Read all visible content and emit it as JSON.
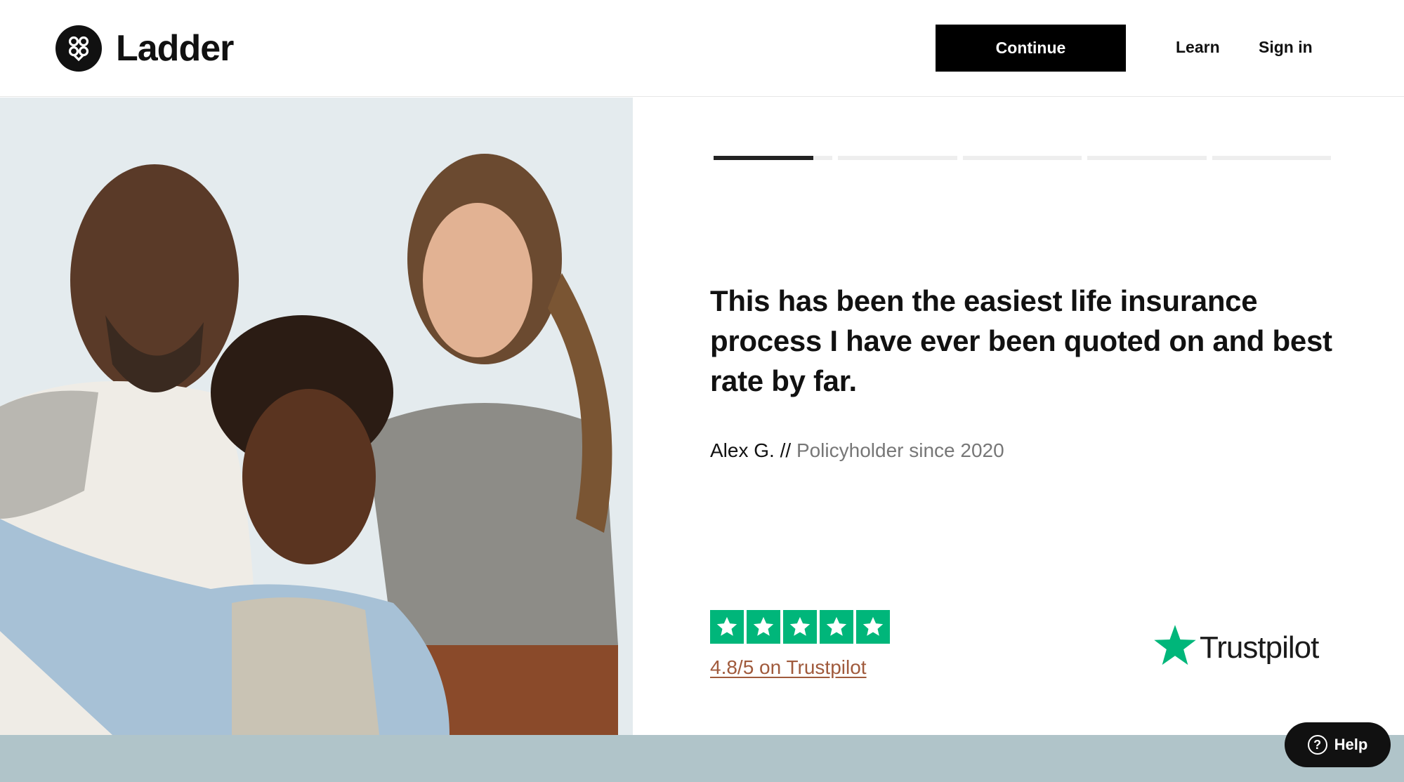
{
  "header": {
    "logo_text": "Ladder",
    "continue_label": "Continue",
    "nav": {
      "learn": "Learn",
      "sign_in": "Sign in"
    }
  },
  "progress": {
    "total_steps": 5,
    "current_step": 1,
    "current_fill": 0.84
  },
  "testimonial": {
    "quote": "This has been the easiest life insurance process I have ever been quoted on and best rate by far.",
    "author": "Alex G. //",
    "since": "Policyholder since 2020"
  },
  "rating": {
    "stars": 5,
    "link_text": "4.8/5 on Trustpilot",
    "trustpilot_brand": "Trustpilot"
  },
  "help": {
    "label": "Help"
  },
  "colors": {
    "accent": "#000000",
    "trustpilot_green": "#00b67a",
    "rating_link": "#a05a3c",
    "photo_bg": "#e4ebee",
    "bottom_band": "#b0c4c9"
  },
  "icons": {
    "logo": "ladder-logo-icon",
    "star": "star-icon",
    "trustpilot": "trustpilot-star-icon",
    "help": "question-circle-icon"
  }
}
